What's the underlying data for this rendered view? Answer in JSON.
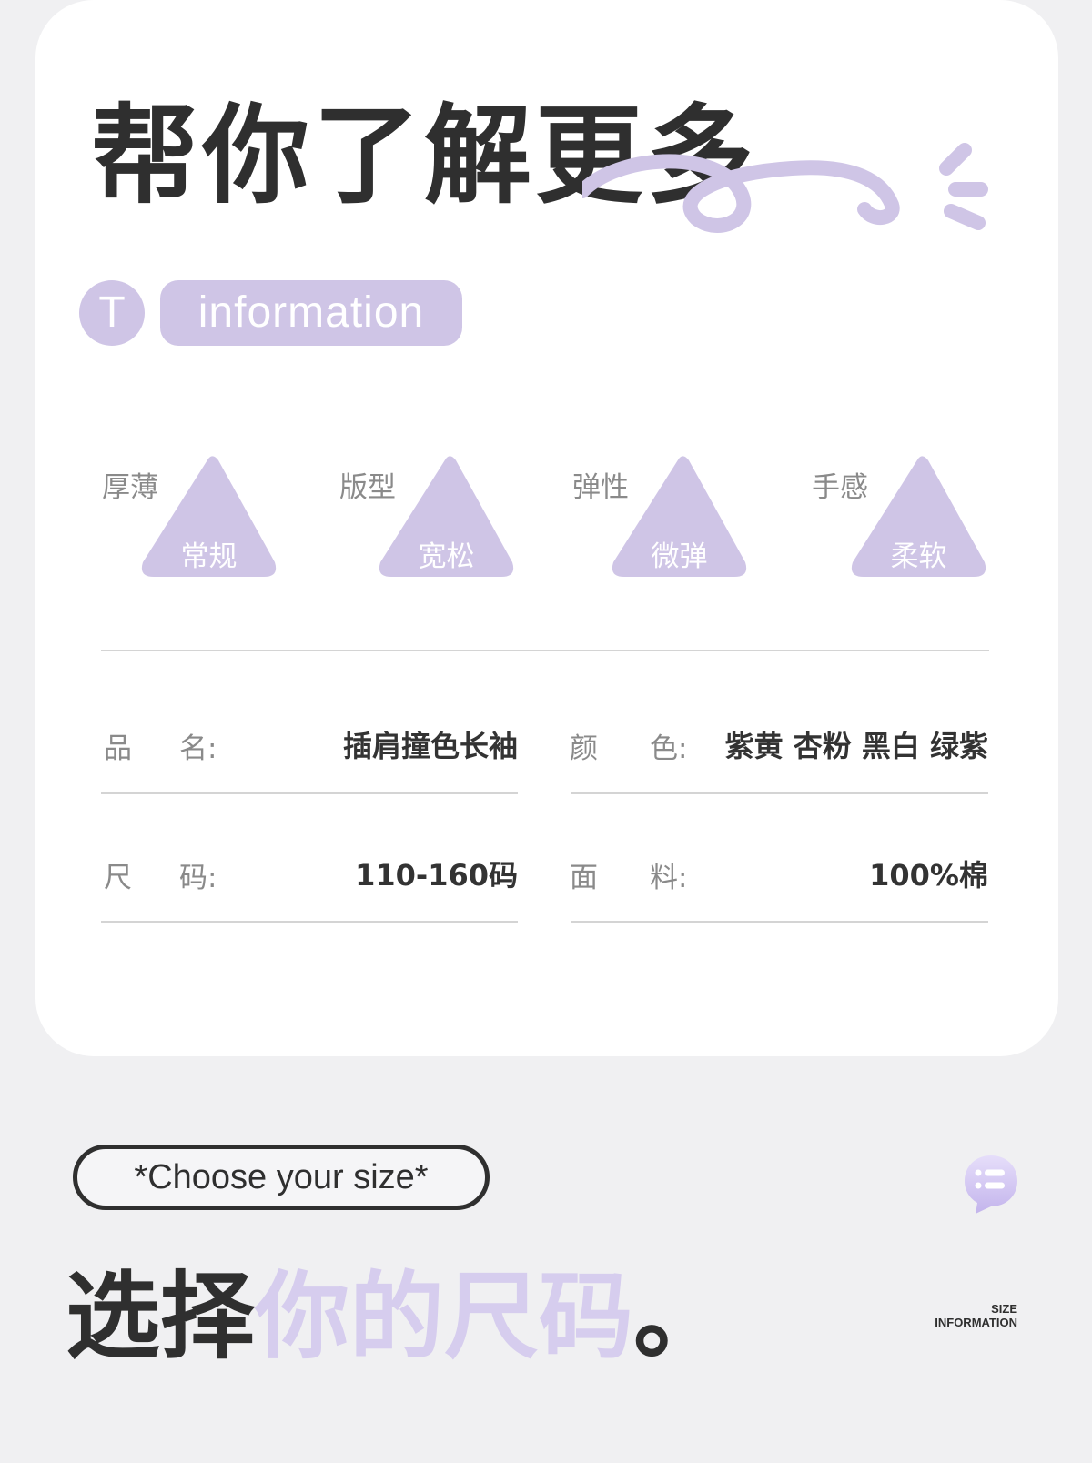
{
  "header": {
    "title": "帮你了解更多",
    "badge_letter": "T",
    "badge_label": "information"
  },
  "attributes": [
    {
      "label": "厚薄",
      "value": "常规"
    },
    {
      "label": "版型",
      "value": "宽松"
    },
    {
      "label": "弹性",
      "value": "微弹"
    },
    {
      "label": "手感",
      "value": "柔软"
    }
  ],
  "details": {
    "name_label_1": "品",
    "name_label_2": "名:",
    "name_value": "插肩撞色长袖",
    "color_label_1": "颜",
    "color_label_2": "色:",
    "color_value": "紫黄 杏粉 黑白 绿紫",
    "size_label_1": "尺",
    "size_label_2": "码:",
    "size_value": "110-160码",
    "fabric_label_1": "面",
    "fabric_label_2": "料:",
    "fabric_value": "100%棉"
  },
  "size_section": {
    "pill_text": "*Choose your size*",
    "title_dark": "选择",
    "title_light": "你的尺码",
    "title_end": "。",
    "caption_line1": "SIZE",
    "caption_line2": "INFORMATION"
  },
  "colors": {
    "accent": "#cfc5e6",
    "title_dark": "#2f2f2f",
    "title_light": "#d6cdee",
    "background": "#f0f0f2"
  },
  "icons": [
    "squiggle-decoration",
    "chat-bubble-list-icon"
  ]
}
